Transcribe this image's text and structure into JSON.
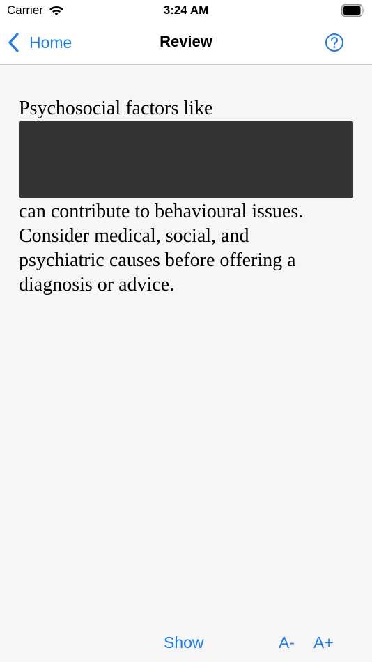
{
  "status_bar": {
    "carrier": "Carrier",
    "time": "3:24 AM"
  },
  "nav": {
    "back_label": "Home",
    "title": "Review",
    "help_icon": "question-circle-icon"
  },
  "content": {
    "before_redaction": "Psychosocial factors like",
    "after_lines": [
      "can contribute to behavioural issues.",
      "Consider medical, social, and",
      "psychiatric causes before offering a",
      "diagnosis or advice."
    ],
    "redacted": true
  },
  "toolbar": {
    "show_label": "Show",
    "font_decrease_label": "A-",
    "font_increase_label": "A+"
  },
  "colors": {
    "accent": "#1a7cf2",
    "background": "#f6f6f6",
    "redaction": "#333333"
  }
}
